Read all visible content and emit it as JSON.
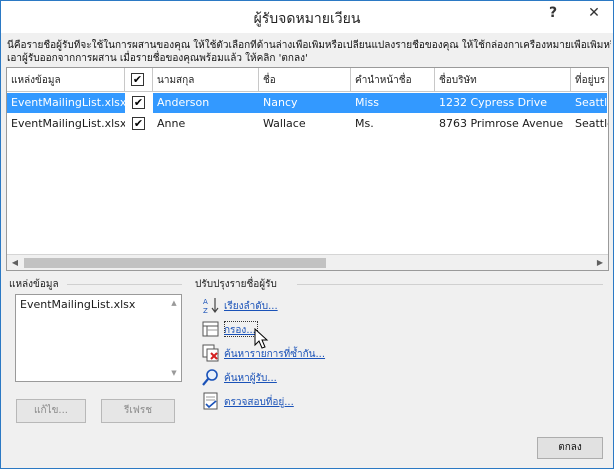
{
  "window": {
    "title": "ผู้รับจดหมายเวียน",
    "help_label": "?",
    "close_label": "✕"
  },
  "instructions": [
    "นี่คือรายชื่อผู้รับที่จะใช้ในการผสานของคุณ  ให้ใช้ตัวเลือกที่ด้านล่างเพื่อเพิ่มหรือเปลี่ยนแปลงรายชื่อของคุณ  ให้ใช้กล่องกาเครื่องหมายเพื่อเพิ่มหรือ",
    "เอาผู้รับออกจากการผสาน  เมื่อรายชื่อของคุณพร้อมแล้ว ให้คลิก 'ตกลง'"
  ],
  "grid": {
    "columns": [
      "แหล่งข้อมูล",
      "",
      "นามสกุล",
      "ชื่อ",
      "คำนำหน้าชื่อ",
      "ชื่อบริษัท",
      "ที่อยู่บร"
    ],
    "rows": [
      {
        "source": "EventMailingList.xlsx",
        "checked": true,
        "last": "Anderson",
        "first": "Nancy",
        "title": "Miss",
        "company": "1232 Cypress Drive",
        "address": "Seattle",
        "selected": true
      },
      {
        "source": "EventMailingList.xlsx",
        "checked": true,
        "last": "Anne",
        "first": "Wallace",
        "title": "Ms.",
        "company": "8763 Primrose Avenue",
        "address": "Seattle",
        "selected": false
      }
    ]
  },
  "data_source": {
    "label": "แหล่งข้อมูล",
    "items": [
      "EventMailingList.xlsx"
    ],
    "edit_label": "แก้ไข...",
    "refresh_label": "รีเฟรช"
  },
  "refine": {
    "label": "ปรับปรุงรายชื่อผู้รับ",
    "links": [
      {
        "label": "เรียงลำดับ...",
        "icon": "sort-icon"
      },
      {
        "label": "กรอง...",
        "icon": "filter-icon"
      },
      {
        "label": "ค้นหารายการที่ซ้ำกัน...",
        "icon": "find-duplicates-icon"
      },
      {
        "label": "ค้นหาผู้รับ...",
        "icon": "find-recipient-icon"
      },
      {
        "label": "ตรวจสอบที่อยู่...",
        "icon": "validate-addresses-icon"
      }
    ]
  },
  "ok_label": "ตกลง",
  "colors": {
    "selection": "#3399ff",
    "link": "#1a52b8",
    "border": "#2b79c4"
  }
}
